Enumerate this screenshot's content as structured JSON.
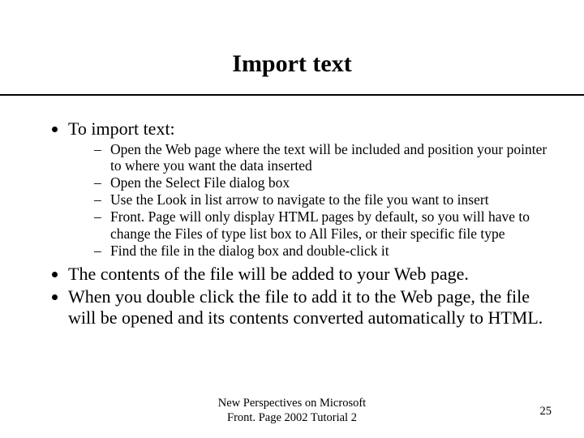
{
  "title": "Import text",
  "bullets": {
    "b1": "To import text:",
    "sub": [
      "Open the Web page where the text will be included and position your pointer to where you want the data inserted",
      "Open the Select File dialog box",
      "Use the Look in list arrow to navigate to the file you want to insert",
      "Front. Page will only display HTML pages by default, so you will have to change the Files of type list box to All Files, or their specific file type",
      "Find the file in the dialog box and double-click it"
    ],
    "b2": "The contents of the file will be added to your Web page.",
    "b3": "When you double click the file to add it to the Web page, the file will be opened and its contents converted automatically to HTML."
  },
  "footer": {
    "line1": "New Perspectives on Microsoft",
    "line2": "Front. Page 2002 Tutorial 2",
    "page": "25"
  }
}
